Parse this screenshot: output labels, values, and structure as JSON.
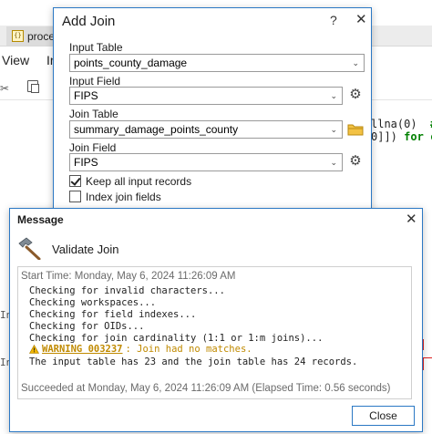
{
  "background": {
    "tab_label": "proce",
    "tab_icon_text": "{}",
    "menu_view": "View",
    "menu_ir": "Ir",
    "code_line1_a": "llna(0)",
    "code_line1_b": "#",
    "code_line2_a": "0]])",
    "code_line2_b": "for c",
    "console_in1": "In",
    "console_in2": "In"
  },
  "add_join": {
    "title": "Add Join",
    "help_label": "?",
    "close_label": "✕",
    "input_table_label": "Input Table",
    "input_table_value": "points_county_damage",
    "input_field_label": "Input Field",
    "input_field_value": "FIPS",
    "join_table_label": "Join Table",
    "join_table_value": "summary_damage_points_county",
    "join_field_label": "Join Field",
    "join_field_value": "FIPS",
    "keep_all_label": "Keep all input records",
    "keep_all_checked": true,
    "index_fields_label": "Index join fields",
    "index_fields_checked": false
  },
  "message": {
    "title": "Message",
    "close_label": "✕",
    "heading": "Validate Join",
    "start_time": "Start Time: Monday, May 6, 2024 11:26:09 AM",
    "lines": [
      "Checking for invalid characters...",
      "Checking workspaces...",
      "Checking for field indexes...",
      "Checking for OIDs...",
      "Checking for join cardinality (1:1 or 1:m joins)..."
    ],
    "warning_code": "WARNING 003237",
    "warning_text": ": Join had no matches.",
    "records_line": "The input table has 23 and the join table has 24 records.",
    "succeeded": "Succeeded at Monday, May 6, 2024 11:26:09 AM (Elapsed Time: 0.56 seconds)",
    "close_button": "Close"
  },
  "colors": {
    "accent": "#2b78c4",
    "warning": "#c08a00"
  }
}
